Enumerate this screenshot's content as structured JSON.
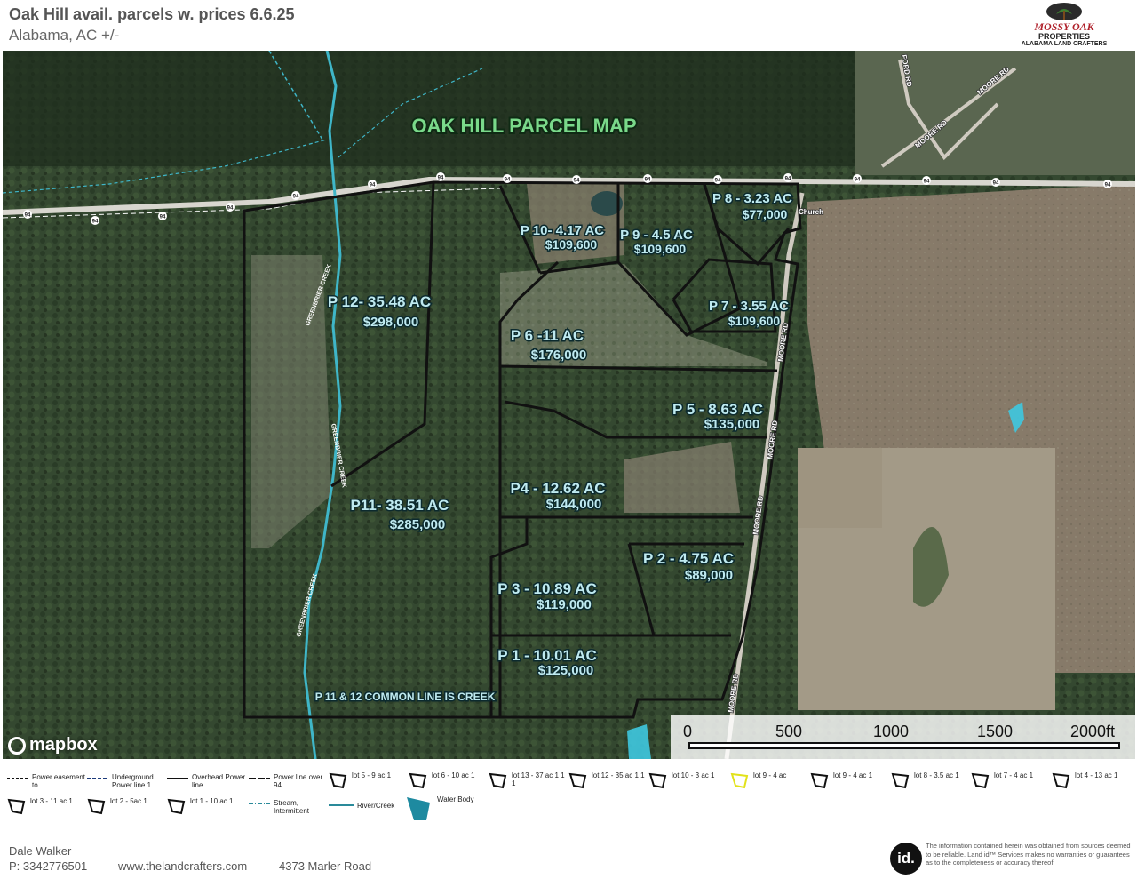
{
  "header": {
    "title": "Oak Hill avail. parcels w. prices 6.6.25",
    "subtitle": "Alabama,  AC +/-"
  },
  "logo": {
    "line1": "MOSSY OAK",
    "line2": "PROPERTIES",
    "line3": "ALABAMA LAND CRAFTERS"
  },
  "map": {
    "heading": "OAK HILL PARCEL MAP",
    "common_line_note": "P 11 & 12 COMMON LINE IS CREEK",
    "road_labels": [
      "MOORE RD",
      "FORD RD",
      "94"
    ],
    "creek_label": "GREENBRIER CREEK",
    "church_label": "Church",
    "parcels": [
      {
        "name": "P 12- 35.48 AC",
        "price": "$298,000"
      },
      {
        "name": "P11- 38.51 AC",
        "price": "$285,000"
      },
      {
        "name": "P 10- 4.17 AC",
        "price": "$109,600"
      },
      {
        "name": "P 9 - 4.5 AC",
        "price": "$109,600"
      },
      {
        "name": "P 8 - 3.23 AC",
        "price": "$77,000"
      },
      {
        "name": "P 7 - 3.55 AC",
        "price": "$109,600"
      },
      {
        "name": "P 6 -11 AC",
        "price": "$176,000"
      },
      {
        "name": "P 5 - 8.63 AC",
        "price": "$135,000"
      },
      {
        "name": "P4 - 12.62 AC",
        "price": "$144,000"
      },
      {
        "name": "P 2 - 4.75 AC",
        "price": "$89,000"
      },
      {
        "name": "P 3 - 10.89 AC",
        "price": "$119,000"
      },
      {
        "name": "P 1 - 10.01 AC",
        "price": "$125,000"
      }
    ],
    "scale": {
      "labels": [
        "0",
        "500",
        "1000",
        "1500",
        "2000ft"
      ]
    },
    "attribution": "mapbox"
  },
  "legend": {
    "row1": [
      {
        "label": "Power easement to",
        "symbol": "dashed-line"
      },
      {
        "label": "Underground Power line 1",
        "symbol": "dash-blue-line"
      },
      {
        "label": "Overhead Power line",
        "symbol": "solid-line"
      },
      {
        "label": "Power line over 94",
        "symbol": "long-dash-line"
      },
      {
        "label": "lot 5  -  9 ac 1",
        "symbol": "polygon"
      },
      {
        "label": "lot 6 - 10 ac  1",
        "symbol": "polygon"
      },
      {
        "label": "lot 13 -  37 ac 1 1 1",
        "symbol": "polygon"
      },
      {
        "label": "lot 12 - 35 ac 1 1",
        "symbol": "polygon"
      },
      {
        "label": "lot 10  -  3 ac 1",
        "symbol": "polygon"
      },
      {
        "label": "lot 9  - 4 ac",
        "symbol": "polygon-yellow"
      },
      {
        "label": "lot 9  - 4 ac 1",
        "symbol": "polygon"
      },
      {
        "label": "lot 8  -  3.5 ac 1",
        "symbol": "polygon"
      },
      {
        "label": "lot 7  -  4 ac 1",
        "symbol": "polygon"
      },
      {
        "label": "lot 4  -  13 ac 1",
        "symbol": "polygon"
      }
    ],
    "row2": [
      {
        "label": "lot 3  -  11 ac 1",
        "symbol": "polygon"
      },
      {
        "label": "lot 2  -  5ac 1",
        "symbol": "polygon"
      },
      {
        "label": "lot 1  -  10 ac 1",
        "symbol": "polygon"
      },
      {
        "label": "Stream, Intermittent",
        "symbol": "stream-line"
      },
      {
        "label": "River/Creek",
        "symbol": "river-line"
      },
      {
        "label": "Water Body",
        "symbol": "water-shape"
      }
    ]
  },
  "footer": {
    "agent_name": "Dale Walker",
    "phone": "P: 3342776501",
    "website": "www.thelandcrafters.com",
    "address": "4373 Marler Road",
    "landid": "id.",
    "disclaimer": "The information contained herein was obtained from sources deemed to be reliable. Land id™ Services makes no warranties or guarantees as to the completeness or accuracy thereof."
  },
  "colors": {
    "parcel_label": "#bfeaf0",
    "parcel_outline": "#111111",
    "creek": "#3fb6c8",
    "water": "#3ec8e0",
    "heading": "#7ad98a"
  }
}
